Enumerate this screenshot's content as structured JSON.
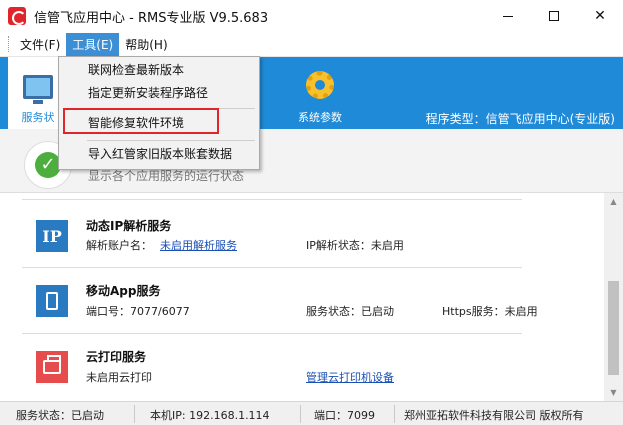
{
  "window": {
    "title": "信管飞应用中心 - RMS专业版 V9.5.683"
  },
  "menubar": {
    "file": "文件(F)",
    "tools": "工具(E)",
    "help": "帮助(H)"
  },
  "dropdown": {
    "items": [
      "联网检查最新版本",
      "指定更新安装程序路径",
      "智能修复软件环境",
      "导入红管家旧版本账套数据"
    ],
    "highlighted": "智能修复软件环境"
  },
  "toolbar": {
    "service_label": "服务状",
    "params_label": "系统参数",
    "program_type": "程序类型：信管飞应用中心(专业版)"
  },
  "header": {
    "description": "显示各个应用服务的运行状态"
  },
  "services": {
    "ip": {
      "icon_text": "IP",
      "title": "动态IP解析服务",
      "account_label": "解析账户名：",
      "account_link": "未启用解析服务",
      "status": "IP解析状态：未启用"
    },
    "app": {
      "title": "移动App服务",
      "port": "端口号：7077/6077",
      "status": "服务状态：已启动",
      "https": "Https服务：未启用"
    },
    "print": {
      "title": "云打印服务",
      "status": "未启用云打印",
      "manage_link": "管理云打印机设备"
    }
  },
  "statusbar": {
    "service_status": "服务状态：已启动",
    "local_ip": "本机IP: 192.168.1.114",
    "port": "端口：7099",
    "copyright": "郑州亚拓软件科技有限公司 版权所有"
  },
  "colors": {
    "accent": "#1f8ad8",
    "highlight_box": "#e0262b",
    "menu_active": "#3c8fd4"
  }
}
